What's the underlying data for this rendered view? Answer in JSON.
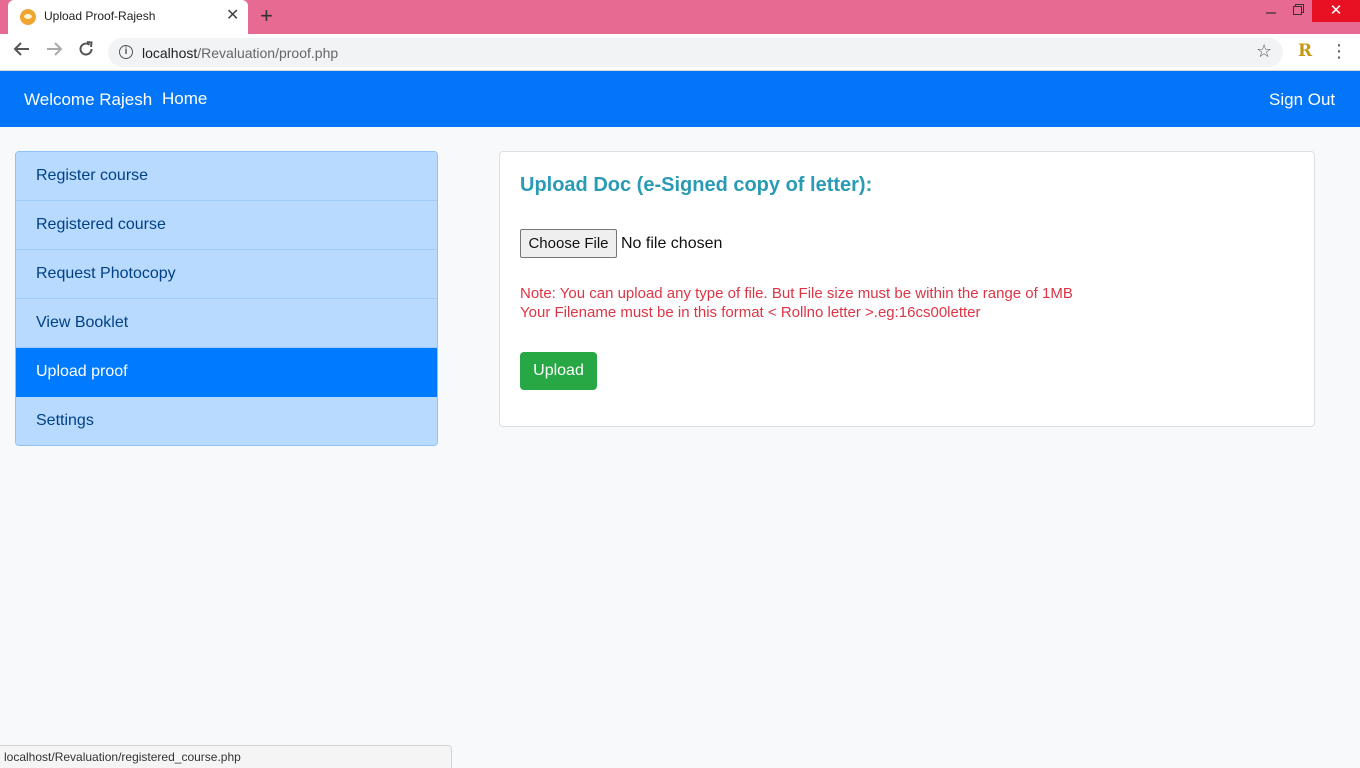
{
  "browser": {
    "tab_title": "Upload Proof-Rajesh",
    "tab_close": "✕",
    "new_tab": "+",
    "url_host": "localhost",
    "url_path": "/Revaluation/proof.php",
    "extension_label": "R",
    "status_text": "localhost/Revaluation/registered_course.php",
    "accent_color": "#e66a92"
  },
  "navbar": {
    "brand": "Welcome Rajesh",
    "home": "Home",
    "sign_out": "Sign Out",
    "color": "#0275f8"
  },
  "sidebar": {
    "items": [
      {
        "label": "Register course",
        "active": false
      },
      {
        "label": "Registered course",
        "active": false
      },
      {
        "label": "Request Photocopy",
        "active": false
      },
      {
        "label": "View Booklet",
        "active": false
      },
      {
        "label": "Upload proof",
        "active": true
      },
      {
        "label": "Settings",
        "active": false
      }
    ]
  },
  "main": {
    "title": "Upload Doc (e-Signed copy of letter):",
    "choose_file_label": "Choose File",
    "file_status": "No file chosen",
    "note_line1": "Note: You can upload any type of file. But File size must be within the range of 1MB",
    "note_line2": "Your Filename must be in this format < Rollno letter >.eg:16cs00letter",
    "upload_label": "Upload",
    "title_color": "#2a9bb5",
    "note_color": "#dc3545",
    "upload_color": "#28a745"
  }
}
